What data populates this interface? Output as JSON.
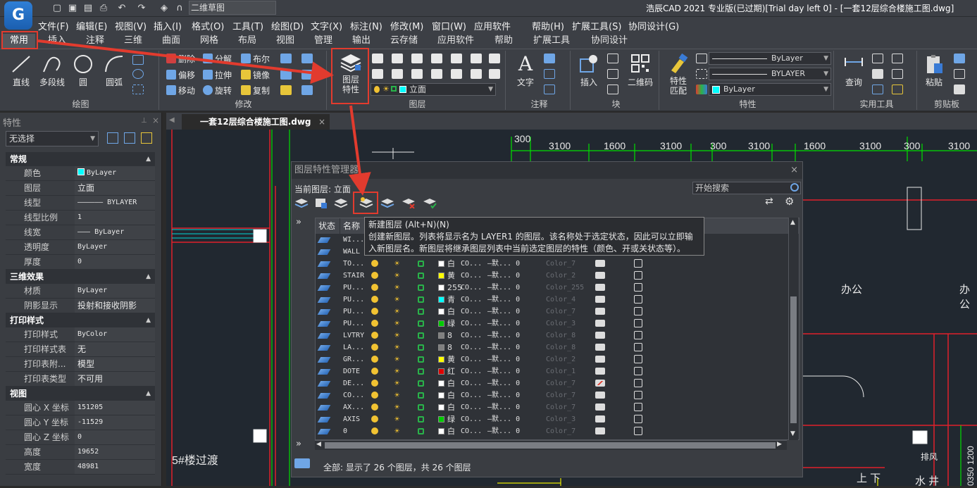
{
  "app": {
    "logo": "G",
    "title": "浩辰CAD 2021 专业版(已过期)[Trial day left 0] - [一套12层综合楼施工图.dwg]",
    "workspace": "二维草图"
  },
  "menu": [
    "文件(F)",
    "编辑(E)",
    "视图(V)",
    "插入(I)",
    "格式(O)",
    "工具(T)",
    "绘图(D)",
    "文字(X)",
    "标注(N)",
    "修改(M)",
    "窗口(W)",
    "应用软件",
    "帮助(H)",
    "扩展工具(S)",
    "协同设计(G)"
  ],
  "tabs": [
    "常用",
    "插入",
    "注释",
    "三维",
    "曲面",
    "网格",
    "布局",
    "视图",
    "管理",
    "输出",
    "云存储",
    "应用软件",
    "帮助",
    "扩展工具",
    "协同设计"
  ],
  "ribbon": {
    "draw": {
      "title": "绘图",
      "line": "直线",
      "pline": "多段线",
      "circle": "圆",
      "arc": "圆弧"
    },
    "modify": {
      "title": "修改",
      "erase": "删除",
      "explode": "分解",
      "boolean": "布尔",
      "offset": "偏移",
      "stretch": "拉伸",
      "mirror": "镜像",
      "move": "移动",
      "rotate": "旋转",
      "copy": "复制"
    },
    "layer": {
      "title": "图层",
      "props": "图层特性",
      "current": "立面"
    },
    "annotation": {
      "title": "注释",
      "text": "文字"
    },
    "block": {
      "title": "块",
      "insert": "插入",
      "qrcode": "二维码"
    },
    "properties": {
      "title": "特性",
      "match": "特性匹配",
      "ltype": "ByLayer",
      "lweight": "BYLAYER",
      "color": "ByLayer"
    },
    "utilities": {
      "title": "实用工具",
      "query": "查询"
    },
    "clipboard": {
      "title": "剪贴板",
      "paste": "粘贴"
    }
  },
  "props_panel": {
    "title": "特性",
    "selection": "无选择",
    "sections": [
      {
        "name": "常规",
        "rows": [
          [
            "颜色",
            "ByLayer"
          ],
          [
            "图层",
            "立面"
          ],
          [
            "线型",
            "—————— BYLAYER"
          ],
          [
            "线型比例",
            "1"
          ],
          [
            "线宽",
            "——— ByLayer"
          ],
          [
            "透明度",
            "ByLayer"
          ],
          [
            "厚度",
            "0"
          ]
        ]
      },
      {
        "name": "三维效果",
        "rows": [
          [
            "材质",
            "ByLayer"
          ],
          [
            "阴影显示",
            "投射和接收阴影"
          ]
        ]
      },
      {
        "name": "打印样式",
        "rows": [
          [
            "打印样式",
            "ByColor"
          ],
          [
            "打印样式表",
            "无"
          ],
          [
            "打印表附...",
            "模型"
          ],
          [
            "打印表类型",
            "不可用"
          ]
        ]
      },
      {
        "name": "视图",
        "rows": [
          [
            "圆心 X 坐标",
            "151205"
          ],
          [
            "圆心 Y 坐标",
            "-11529"
          ],
          [
            "圆心 Z 坐标",
            "0"
          ],
          [
            "高度",
            "19652"
          ],
          [
            "宽度",
            "48981"
          ]
        ]
      }
    ]
  },
  "document": {
    "tab": "一套12层综合楼施工图.dwg"
  },
  "drawing": {
    "dims": [
      "300",
      "3100",
      "1600",
      "3100",
      "300",
      "3100",
      "1600",
      "3100",
      "300",
      "3100"
    ],
    "labels": [
      "办公",
      "办公",
      "5#楼过渡",
      "排风",
      "上 下",
      "水 井",
      "0350 1200"
    ]
  },
  "layer_manager": {
    "title": "图层特性管理器",
    "current_label": "当前图层: 立面",
    "search_placeholder": "开始搜索",
    "columns": [
      "状态",
      "名称"
    ],
    "tooltip_title": "新建图层 (Alt+N)(N)",
    "tooltip_body": "创建新图层。列表将显示名为 LAYER1 的图层。该名称处于选定状态，因此可以立即输入新图层名。新图层将继承图层列表中当前选定图层的特性（颜色、开或关状态等）。",
    "status": "全部: 显示了 26 个图层，共 26 个图层",
    "layers": [
      {
        "name": "WI...",
        "color": "#ffffff",
        "cname": "",
        "lt": "",
        "lw": "",
        "ps": ""
      },
      {
        "name": "WALL",
        "color": "#ffffff",
        "cname": "",
        "lt": "",
        "lw": "",
        "ps": ""
      },
      {
        "name": "TO...",
        "color": "#ffffff",
        "cname": "白",
        "lt": "CO...",
        "lw": "—默... 0",
        "ps": "Color_7"
      },
      {
        "name": "STAIR",
        "color": "#ffff00",
        "cname": "黄",
        "lt": "CO...",
        "lw": "—默... 0",
        "ps": "Color_2"
      },
      {
        "name": "PU...",
        "color": "#ffffff",
        "cname": "255",
        "lt": "CO...",
        "lw": "—默... 0",
        "ps": "Color_255"
      },
      {
        "name": "PU...",
        "color": "#00ffff",
        "cname": "青",
        "lt": "CO...",
        "lw": "—默... 0",
        "ps": "Color_4"
      },
      {
        "name": "PU...",
        "color": "#ffffff",
        "cname": "白",
        "lt": "CO...",
        "lw": "—默... 0",
        "ps": "Color_7"
      },
      {
        "name": "PU...",
        "color": "#00cc00",
        "cname": "绿",
        "lt": "CO...",
        "lw": "—默... 0",
        "ps": "Color_3"
      },
      {
        "name": "LVTRY",
        "color": "#808080",
        "cname": "8",
        "lt": "CO...",
        "lw": "—默... 0",
        "ps": "Color_8"
      },
      {
        "name": "LA...",
        "color": "#808080",
        "cname": "8",
        "lt": "CO...",
        "lw": "—默... 0",
        "ps": "Color_8"
      },
      {
        "name": "GR...",
        "color": "#ffff00",
        "cname": "黄",
        "lt": "CO...",
        "lw": "—默... 0",
        "ps": "Color_2"
      },
      {
        "name": "DOTE",
        "color": "#e00000",
        "cname": "红",
        "lt": "CO...",
        "lw": "—默... 0",
        "ps": "Color_1"
      },
      {
        "name": "DE...",
        "color": "#ffffff",
        "cname": "白",
        "lt": "CO...",
        "lw": "—默... 0",
        "ps": "Color_7"
      },
      {
        "name": "CO...",
        "color": "#ffffff",
        "cname": "白",
        "lt": "CO...",
        "lw": "—默... 0",
        "ps": "Color_7"
      },
      {
        "name": "AX...",
        "color": "#ffffff",
        "cname": "白",
        "lt": "CO...",
        "lw": "—默... 0",
        "ps": "Color_7"
      },
      {
        "name": "AXIS",
        "color": "#00cc00",
        "cname": "绿",
        "lt": "CO...",
        "lw": "—默... 0",
        "ps": "Color_3"
      },
      {
        "name": "0",
        "color": "#ffffff",
        "cname": "白",
        "lt": "CO...",
        "lw": "—默... 0",
        "ps": "Color_7"
      }
    ]
  },
  "colors": {
    "accent_red": "#e23b2e",
    "cad_bg": "#212830",
    "line_red": "#e0202a",
    "line_green": "#00e000",
    "line_yellow": "#e8e800"
  }
}
